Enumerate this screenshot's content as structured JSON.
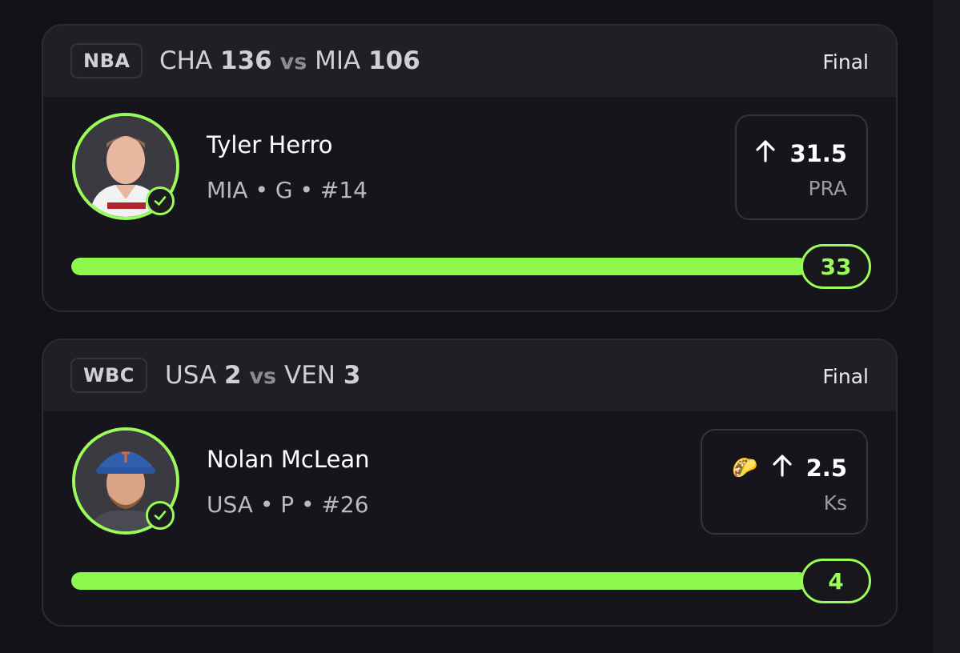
{
  "cards": [
    {
      "league": "NBA",
      "team_a": "CHA",
      "score_a": "136",
      "vs": "vs",
      "team_b": "MIA",
      "score_b": "106",
      "status": "Final",
      "player_name": "Tyler Herro",
      "player_meta": "MIA • G • #14",
      "pick_value": "31.5",
      "pick_stat": "PRA",
      "result": "33",
      "progress": 1.0
    },
    {
      "league": "WBC",
      "team_a": "USA",
      "score_a": "2",
      "vs": "vs",
      "team_b": "VEN",
      "score_b": "3",
      "status": "Final",
      "player_name": "Nolan McLean",
      "player_meta": "USA • P • #26",
      "pick_emoji": "🌮",
      "pick_value": "2.5",
      "pick_stat": "Ks",
      "result": "4",
      "progress": 1.0
    }
  ],
  "icons": {
    "direction": "arrow-up-icon",
    "status": "check-circle-icon"
  },
  "colors": {
    "accent": "#9afb5a",
    "background": "#121217"
  }
}
